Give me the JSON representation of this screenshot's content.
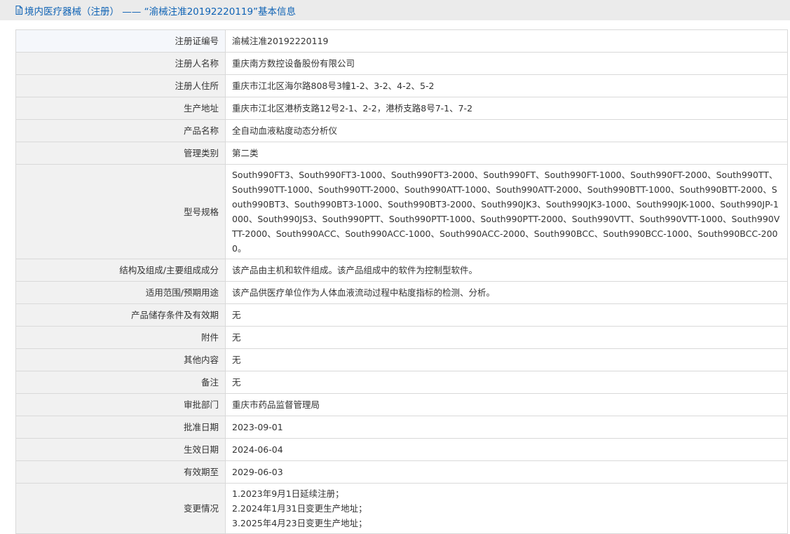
{
  "header": {
    "title": "境内医疗器械（注册） —— “渝械注准20192220119”基本信息",
    "icon": "document-icon"
  },
  "rows": [
    {
      "label": "注册证编号",
      "value": "渝械注准20192220119"
    },
    {
      "label": "注册人名称",
      "value": "重庆南方数控设备股份有限公司"
    },
    {
      "label": "注册人住所",
      "value": "重庆市江北区海尔路808号3幢1-2、3-2、4-2、5-2"
    },
    {
      "label": "生产地址",
      "value": "重庆市江北区港桥支路12号2-1、2-2，港桥支路8号7-1、7-2"
    },
    {
      "label": "产品名称",
      "value": "全自动血液粘度动态分析仪"
    },
    {
      "label": "管理类别",
      "value": "第二类"
    },
    {
      "label": "型号规格",
      "value": "South990FT3、South990FT3-1000、South990FT3-2000、South990FT、South990FT-1000、South990FT-2000、South990TT、South990TT-1000、South990TT-2000、South990ATT-1000、South990ATT-2000、South990BTT-1000、South990BTT-2000、South990BT3、South990BT3-1000、South990BT3-2000、South990JK3、South990JK3-1000、South990JK-1000、South990JP-1000、South990JS3、South990PTT、South990PTT-1000、South990PTT-2000、South990VTT、South990VTT-1000、South990VTT-2000、South990ACC、South990ACC-1000、South990ACC-2000、South990BCC、South990BCC-1000、South990BCC-2000。"
    },
    {
      "label": "结构及组成/主要组成成分",
      "value": "该产品由主机和软件组成。该产品组成中的软件为控制型软件。"
    },
    {
      "label": "适用范围/预期用途",
      "value": "该产品供医疗单位作为人体血液流动过程中粘度指标的检测、分析。"
    },
    {
      "label": "产品储存条件及有效期",
      "value": "无"
    },
    {
      "label": "附件",
      "value": "无"
    },
    {
      "label": "其他内容",
      "value": "无"
    },
    {
      "label": "备注",
      "value": "无"
    },
    {
      "label": "审批部门",
      "value": "重庆市药品监督管理局"
    },
    {
      "label": "批准日期",
      "value": "2023-09-01"
    },
    {
      "label": "生效日期",
      "value": "2024-06-04"
    },
    {
      "label": "有效期至",
      "value": "2029-06-03"
    }
  ],
  "changes": {
    "label": "变更情况",
    "lines": [
      "1.2023年9月1日延续注册；",
      "2.2024年1月31日变更生产地址；",
      "3.2025年4月23日变更生产地址；"
    ]
  }
}
